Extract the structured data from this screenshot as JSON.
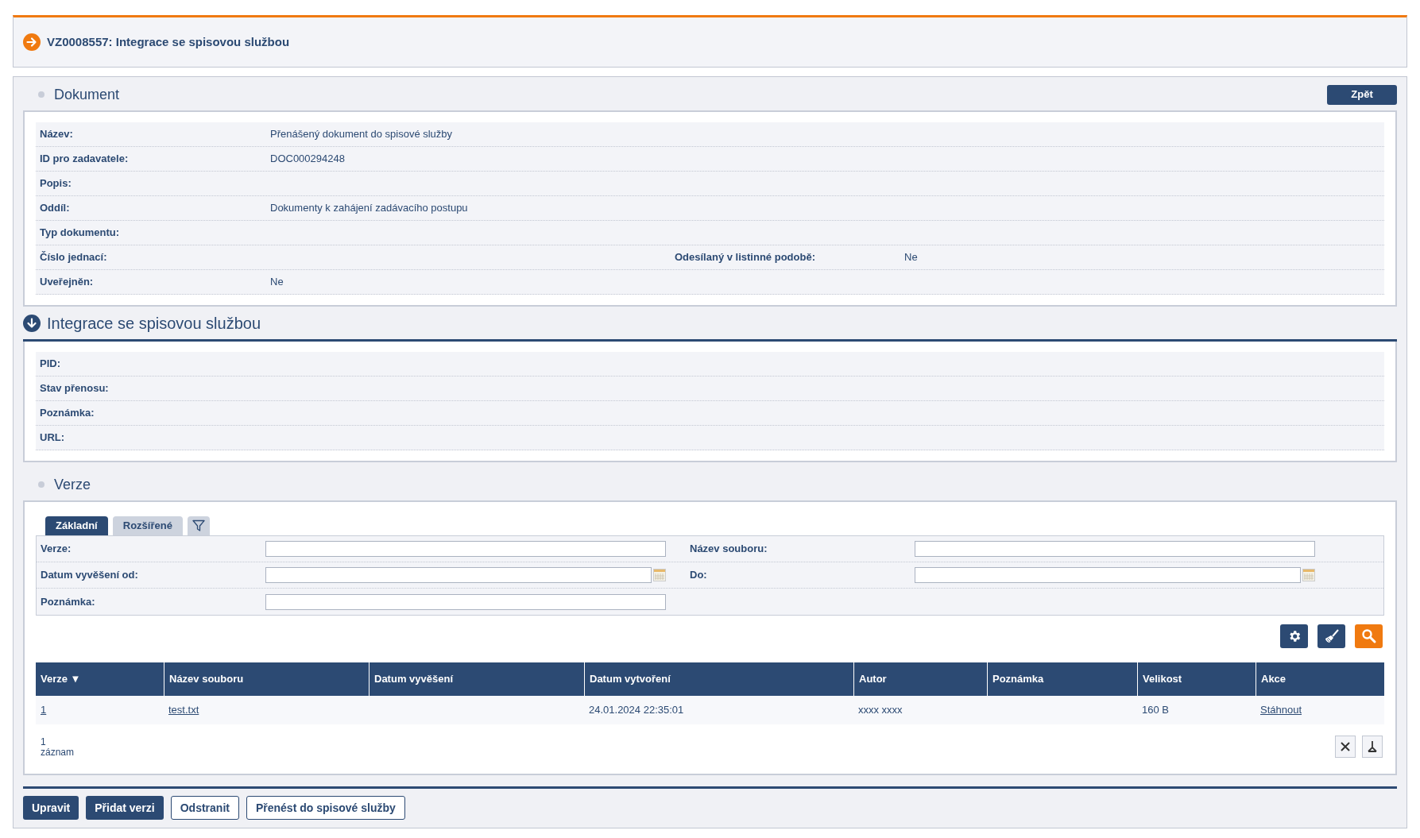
{
  "header": {
    "title": "VZ0008557: Integrace se spisovou službou"
  },
  "document": {
    "title": "Dokument",
    "back_button": "Zpět",
    "fields": [
      {
        "label": "Název:",
        "value": "Přenášený dokument do spisové služby"
      },
      {
        "label": "ID pro zadavatele:",
        "value": "DOC000294248"
      },
      {
        "label": "Popis:"
      },
      {
        "label": "Oddíl:",
        "value": "Dokumenty k zahájení zadávacího postupu"
      },
      {
        "label": "Typ dokumentu:"
      },
      {
        "label": "Číslo jednací:",
        "label_2": "Odesílaný v listinné podobě:",
        "value_2": "Ne"
      },
      {
        "label": "Uveřejněn:",
        "value": "Ne"
      }
    ]
  },
  "integration": {
    "title": "Integrace se spisovou službou",
    "fields": [
      {
        "label": "PID:"
      },
      {
        "label": "Stav přenosu:"
      },
      {
        "label": "Poznámka:"
      },
      {
        "label": "URL:"
      }
    ]
  },
  "versions": {
    "title": "Verze",
    "tabs": [
      {
        "label": "Základní",
        "selected": true
      },
      {
        "label": "Rozšířené",
        "selected": false
      }
    ],
    "filters": [
      [
        {
          "label": "Verze:",
          "kind": "text"
        },
        {
          "label": "Název souboru:",
          "kind": "text"
        }
      ],
      [
        {
          "label": "Datum vyvěšení od:",
          "kind": "date"
        },
        {
          "label": "Do:",
          "kind": "date"
        }
      ],
      [
        {
          "label": "Poznámka:",
          "kind": "text"
        }
      ]
    ],
    "table": {
      "columns": [
        "Verze ▼",
        "Název souboru",
        "Datum vyvěšení",
        "Datum vytvoření",
        "Autor",
        "Poznámka",
        "Velikost",
        "Akce"
      ],
      "rows": [
        [
          {
            "text": "1",
            "link": true
          },
          {
            "text": "test.txt",
            "link": true
          },
          null,
          {
            "text": "24.01.2024 22:35:01",
            "link": false
          },
          {
            "text": "xxxx xxxx",
            "link": false
          },
          null,
          {
            "text": "160 B",
            "link": false
          },
          {
            "text": "Stáhnout",
            "link": true
          }
        ]
      ]
    },
    "count": "1",
    "count_label": "záznam"
  },
  "buttons": [
    {
      "label": "Upravit",
      "kind": "primary"
    },
    {
      "label": "Přidat verzi",
      "kind": "primary"
    },
    {
      "label": "Odstranit",
      "kind": "outline"
    },
    {
      "label": "Přenést do spisové služby",
      "kind": "outline"
    }
  ]
}
